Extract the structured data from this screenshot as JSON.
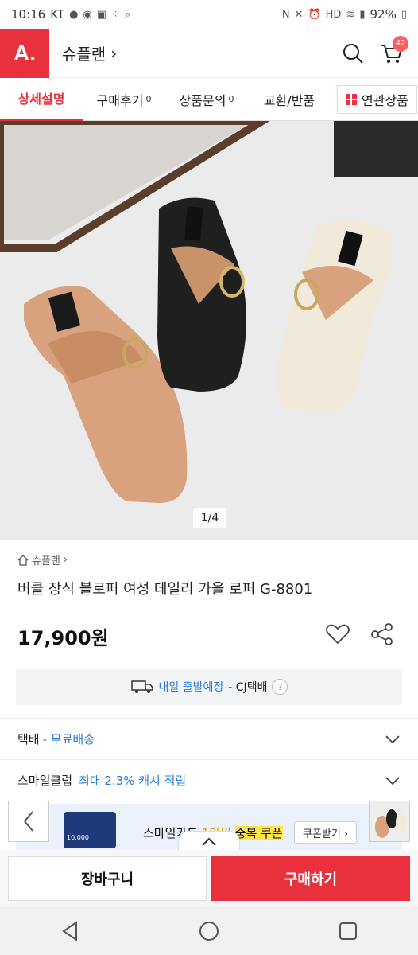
{
  "status": {
    "time": "10:16",
    "carrier": "KT",
    "battery": "92%",
    "icons": [
      "chat-icon",
      "lock-app-icon",
      "camera-icon",
      "dots-icon",
      "search-icon",
      "nfc-icon",
      "mute-icon",
      "alarm-icon",
      "hd-icon",
      "wifi-icon",
      "signal-icon",
      "battery-icon"
    ]
  },
  "header": {
    "logo": "A.",
    "store_title": "슈플랜",
    "store_chevron": "›",
    "cart_count": "42"
  },
  "tabs": [
    {
      "label": "상세설명",
      "count": ""
    },
    {
      "label": "구매후기",
      "count": "0"
    },
    {
      "label": "상품문의",
      "count": "0"
    },
    {
      "label": "교환/반품",
      "count": ""
    },
    {
      "label": "연관상품",
      "count": ""
    }
  ],
  "hero": {
    "pager": "1/4",
    "colors": [
      "#d9a27e",
      "#1f1f1f",
      "#f1eadb"
    ]
  },
  "product": {
    "store_crumb": "슈플랜",
    "name": "버클 장식 블로퍼 여성 데일리 가을 로퍼 G-8801",
    "price": "17,900원"
  },
  "shipping_box": {
    "highlight": "내일 출발예정",
    "suffix": "- CJ택배",
    "help": "?"
  },
  "rows": {
    "delivery_label": "택배",
    "delivery_value": "- 무료배송",
    "club_label": "스마일클럽",
    "club_value": "최대 2.3% 캐시 적립"
  },
  "banner": {
    "card_label": "10,000",
    "text_prefix": "스마일카드",
    "text_hidden": "1만원",
    "text_suffix": "중복 쿠폰",
    "coupon_button": "쿠폰받기 ›"
  },
  "buttons": {
    "cart": "장바구니",
    "buy": "구매하기"
  },
  "accent": "#e8313c",
  "link_blue": "#2a7ad9"
}
